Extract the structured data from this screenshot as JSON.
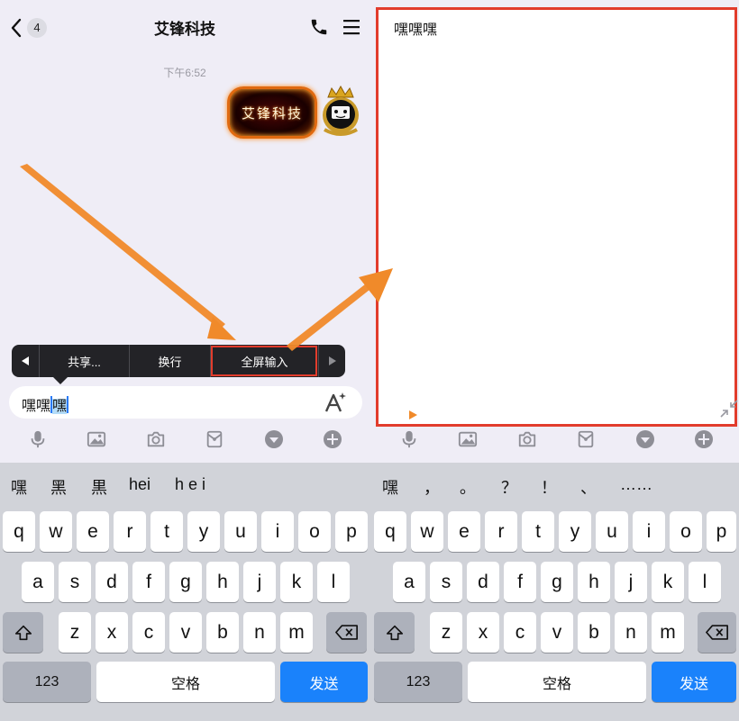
{
  "left": {
    "nav": {
      "unread_count": "4",
      "title": "艾锋科技"
    },
    "timestamp": "下午6:52",
    "message_sticker_text": "艾锋科技",
    "context_menu": {
      "items": [
        "共享...",
        "换行",
        "全屏输入"
      ]
    },
    "input": {
      "text_before": "嘿嘿",
      "text_selected": "嘿"
    },
    "toolbar": {
      "icons": [
        "microphone-icon",
        "image-icon",
        "camera-icon",
        "red-packet-icon",
        "emoji-icon",
        "plus-icon"
      ]
    }
  },
  "right": {
    "fullscreen_text": "嘿嘿嘿"
  },
  "keyboard_left": {
    "candidates": [
      "嘿",
      "黑",
      "黒",
      "hei",
      "h e i"
    ],
    "row1": [
      "q",
      "w",
      "e",
      "r",
      "t",
      "y",
      "u",
      "i",
      "o",
      "p"
    ],
    "row2": [
      "a",
      "s",
      "d",
      "f",
      "g",
      "h",
      "j",
      "k",
      "l"
    ],
    "row3": [
      "z",
      "x",
      "c",
      "v",
      "b",
      "n",
      "m"
    ],
    "num_label": "123",
    "space_label": "空格",
    "send_label": "发送"
  },
  "keyboard_right": {
    "candidates": [
      "嘿",
      "，",
      "。",
      "？",
      "！",
      "、",
      "……"
    ],
    "row1": [
      "q",
      "w",
      "e",
      "r",
      "t",
      "y",
      "u",
      "i",
      "o",
      "p"
    ],
    "row2": [
      "a",
      "s",
      "d",
      "f",
      "g",
      "h",
      "j",
      "k",
      "l"
    ],
    "row3": [
      "z",
      "x",
      "c",
      "v",
      "b",
      "n",
      "m"
    ],
    "num_label": "123",
    "space_label": "空格",
    "send_label": "发送"
  },
  "colors": {
    "highlight_border": "#e23c2c",
    "arrow": "#f08a2a",
    "send_button": "#1a82fb"
  }
}
